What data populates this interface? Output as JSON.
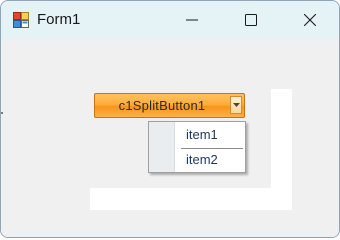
{
  "window": {
    "title": "Form1",
    "icon": "winforms-app-icon",
    "controls": {
      "minimize_icon": "minimize-icon",
      "maximize_icon": "maximize-icon",
      "close_icon": "close-icon"
    }
  },
  "split_button": {
    "label": "c1SplitButton1",
    "arrow_icon": "chevron-down-icon",
    "colors": {
      "fill_top": "#ffc261",
      "fill_bottom": "#f8951a",
      "border": "#c77512"
    }
  },
  "dropdown": {
    "items": [
      {
        "label": "item1"
      },
      {
        "label": "item2"
      }
    ],
    "text_color": "#1e395b"
  }
}
